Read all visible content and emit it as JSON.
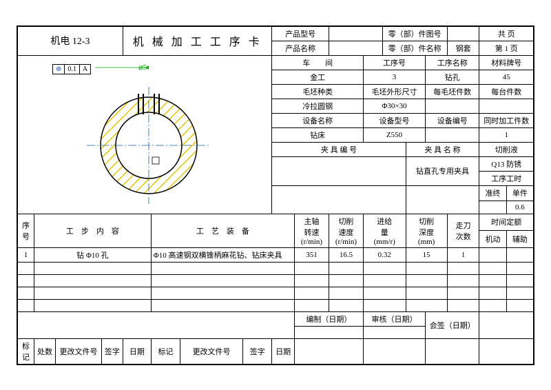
{
  "header": {
    "org": "机电 12-3",
    "title": "机 械 加 工 工 序 卡",
    "product_model_label": "产品型号",
    "part_drawing_no_label": "零（部）件图号",
    "total_pages_label": "共 页",
    "product_name_label": "产品名称",
    "part_name_label": "零（部）件名称",
    "part_name": "钢套",
    "page": "第 1 页"
  },
  "info": {
    "workshop_label": "车　　间",
    "process_no_label": "工序号",
    "process_name_label": "工序名称",
    "material_label": "材料牌号",
    "workshop": "金工",
    "process_no": "3",
    "process_name": "钻孔",
    "material": "45",
    "blank_type_label": "毛坯种类",
    "blank_size_label": "毛坯外形尺寸",
    "per_blank_label": "每毛坯件数",
    "per_machine_label": "每台件数",
    "blank_type": "冷拉圆钢",
    "blank_size": "Φ30×30",
    "equip_name_label": "设备名称",
    "equip_model_label": "设备型号",
    "equip_no_label": "设备编号",
    "simul_label": "同时加工件数",
    "equip_name": "钻床",
    "equip_model": "Z550",
    "simul_count": "1",
    "fixture_no_label": "夹 具 编 号",
    "fixture_name_label": "夹 具 名 称",
    "coolant_label": "切削液",
    "fixture_name": "钻直孔专用夹具",
    "coolant": "Q13 防锈",
    "time_label": "工序工时",
    "prep_label": "准终",
    "unit_label": "单件",
    "unit_time": "0.6"
  },
  "columns": {
    "seq": "序号",
    "step": "工　步　内　容",
    "equipment": "工　艺　装　备",
    "spindle1": "主轴",
    "spindle2": "转速",
    "spindle3": "(r/min)",
    "speed1": "切削",
    "speed2": "速度",
    "speed3": "(r/min)",
    "feed1": "进给",
    "feed2": "量",
    "feed3": "(mm/r)",
    "depth1": "切削",
    "depth2": "深度",
    "depth3": "(mm)",
    "passes1": "走刀",
    "passes2": "次数",
    "time_quota": "时间定额",
    "motor": "机动",
    "aux": "辅助"
  },
  "rows": [
    {
      "n": "1",
      "step": "钻 Φ10 孔",
      "equip": "Φ10 高速钢双横锥柄麻花钻、钻床夹具",
      "spindle": "351",
      "speed": "16.5",
      "feed": "0.32",
      "depth": "15",
      "passes": "1"
    }
  ],
  "footer": {
    "prepare": "编制（日期）",
    "check": "审核（日期）",
    "approve": "会签（日期）",
    "mark": "标记",
    "sheets": "处数",
    "change": "更改文件号",
    "sign": "签字",
    "date": "日期"
  },
  "diagram": {
    "tol_symbol": "⊕",
    "tol_val": "0.1",
    "tol_ref": "A",
    "dim": "⌀5"
  }
}
